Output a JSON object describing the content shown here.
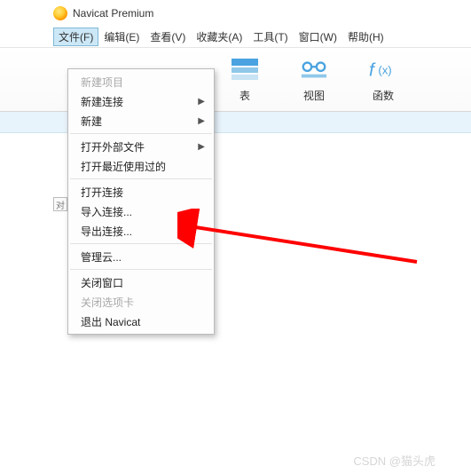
{
  "app": {
    "title": "Navicat Premium"
  },
  "menubar": {
    "file": "文件(F)",
    "edit": "编辑(E)",
    "view": "查看(V)",
    "favorites": "收藏夹(A)",
    "tools": "工具(T)",
    "window": "窗口(W)",
    "help": "帮助(H)"
  },
  "toolbar": {
    "table": "表",
    "view_btn": "视图",
    "function": "函数"
  },
  "dropdown": {
    "new_project": "新建项目",
    "new_connection": "新建连接",
    "new": "新建",
    "open_external": "打开外部文件",
    "open_recent": "打开最近使用过的",
    "open_connection": "打开连接",
    "import_connection": "导入连接...",
    "export_connection": "导出连接...",
    "manage_cloud": "管理云...",
    "close_window": "关闭窗口",
    "close_tab": "关闭选项卡",
    "exit": "退出 Navicat"
  },
  "side_tab": "对",
  "watermark": "CSDN @猫头虎"
}
